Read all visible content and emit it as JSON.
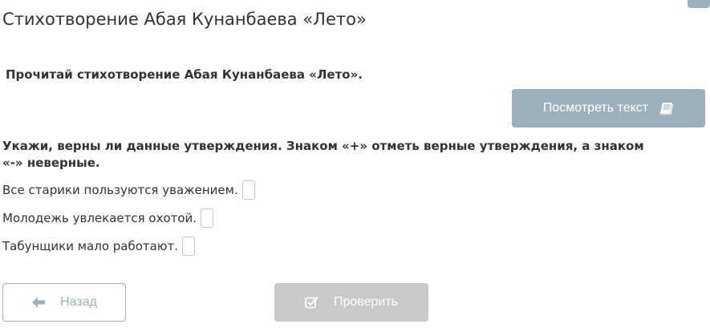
{
  "title": "Стихотворение Абая Кунанбаева «Лето»",
  "instruction": "Прочитай стихотворение Абая Кунанбаева «Лето».",
  "view_text_button": {
    "label": "Посмотреть текст",
    "icon": "book-icon"
  },
  "question": "Укажи, верны ли данные утверждения. Знаком «+» отметь верные утверждения, а знаком «-» неверные.",
  "statements": [
    {
      "text": "Все старики пользуются уважением.",
      "answer": ""
    },
    {
      "text": "Молодежь увлекается охотой.",
      "answer": ""
    },
    {
      "text": "Табунщики мало работают.",
      "answer": ""
    }
  ],
  "back_button": {
    "label": "Назад",
    "icon": "arrow-left-icon"
  },
  "check_button": {
    "label": "Проверить",
    "icon": "checkbox-checked-icon",
    "state": "disabled"
  },
  "colors": {
    "primary_button": "#9fb0bd",
    "disabled_button": "#c9c9c9",
    "text": "#333333"
  }
}
